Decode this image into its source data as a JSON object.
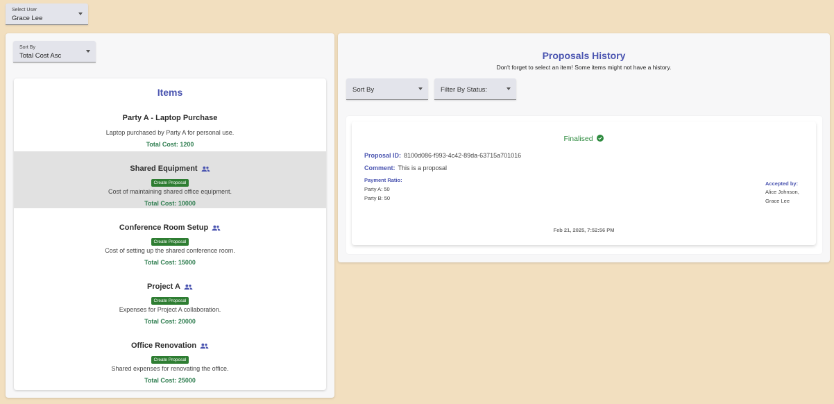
{
  "user_select": {
    "label": "Select User",
    "value": "Grace Lee"
  },
  "sort_select": {
    "label": "Sort By",
    "value": "Total Cost Asc"
  },
  "items": {
    "title": "Items",
    "create_label": "Create Proposal",
    "list": [
      {
        "name": "Party A - Laptop Purchase",
        "shared": false,
        "description": "Laptop purchased by Party A for personal use.",
        "cost": "Total Cost: 1200"
      },
      {
        "name": "Shared Equipment",
        "shared": true,
        "description": "Cost of maintaining shared office equipment.",
        "cost": "Total Cost: 10000"
      },
      {
        "name": "Conference Room Setup",
        "shared": true,
        "description": "Cost of setting up the shared conference room.",
        "cost": "Total Cost: 15000"
      },
      {
        "name": "Project A",
        "shared": true,
        "description": "Expenses for Project A collaboration.",
        "cost": "Total Cost: 20000"
      },
      {
        "name": "Office Renovation",
        "shared": true,
        "description": "Shared expenses for renovating the office.",
        "cost": "Total Cost: 25000"
      }
    ]
  },
  "history": {
    "title": "Proposals History",
    "subtitle": "Don't forget to select an item! Some items might not have a history.",
    "sort_placeholder": "Sort By",
    "filter_placeholder": "Filter By Status:",
    "proposal": {
      "status": "Finalised",
      "id_label": "Proposal ID:",
      "id": "8100d086-f993-4c42-89da-63715a701016",
      "comment_label": "Comment:",
      "comment": "This is a proposal",
      "ratio_label": "Payment Ratio:",
      "ratio_a": "Party A: 50",
      "ratio_b": "Party B: 50",
      "accepted_label": "Accepted by:",
      "accepted_1": "Alice Johnson,",
      "accepted_2": "Grace Lee",
      "timestamp": "Feb 21, 2025, 7:52:56 PM"
    }
  },
  "colors": {
    "accent": "#4a54b0",
    "success": "#2e7d32",
    "background": "#f2dfbf"
  }
}
